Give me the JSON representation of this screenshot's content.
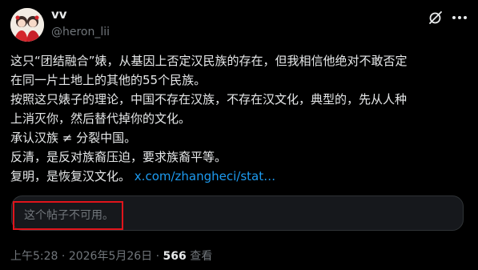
{
  "author": {
    "name": "vv",
    "handle": "@heron_lii"
  },
  "icons": {
    "grok": "grok-icon",
    "more": "more-icon"
  },
  "body": {
    "lines": [
      "这只“团结融合”婊，从基因上否定汉民族的存在，但我相信他绝对不敢否定",
      "在同一片土地上的其他的55个民族。",
      "按照这只婊子的理论，中国不存在汉族，不存在汉文化，典型的，先从人种",
      "上消灭你，然后替代掉你的文化。",
      "承认汉族 ≠ 分裂中国。",
      "反清，是反对族裔压迫，要求族裔平等。",
      "复明，是恢复汉文化。"
    ],
    "link": "x.com/zhangheci/stat…"
  },
  "quote": {
    "unavailable_text": "这个帖子不可用。"
  },
  "meta": {
    "time": "上午5:28",
    "separator": " · ",
    "date": "2026年5月26日",
    "views": "566",
    "views_label": "查看"
  },
  "colors": {
    "background": "#000000",
    "text": "#e7e9ea",
    "secondary": "#71767b",
    "link": "#1d9bf0",
    "highlight": "#e0141b"
  }
}
